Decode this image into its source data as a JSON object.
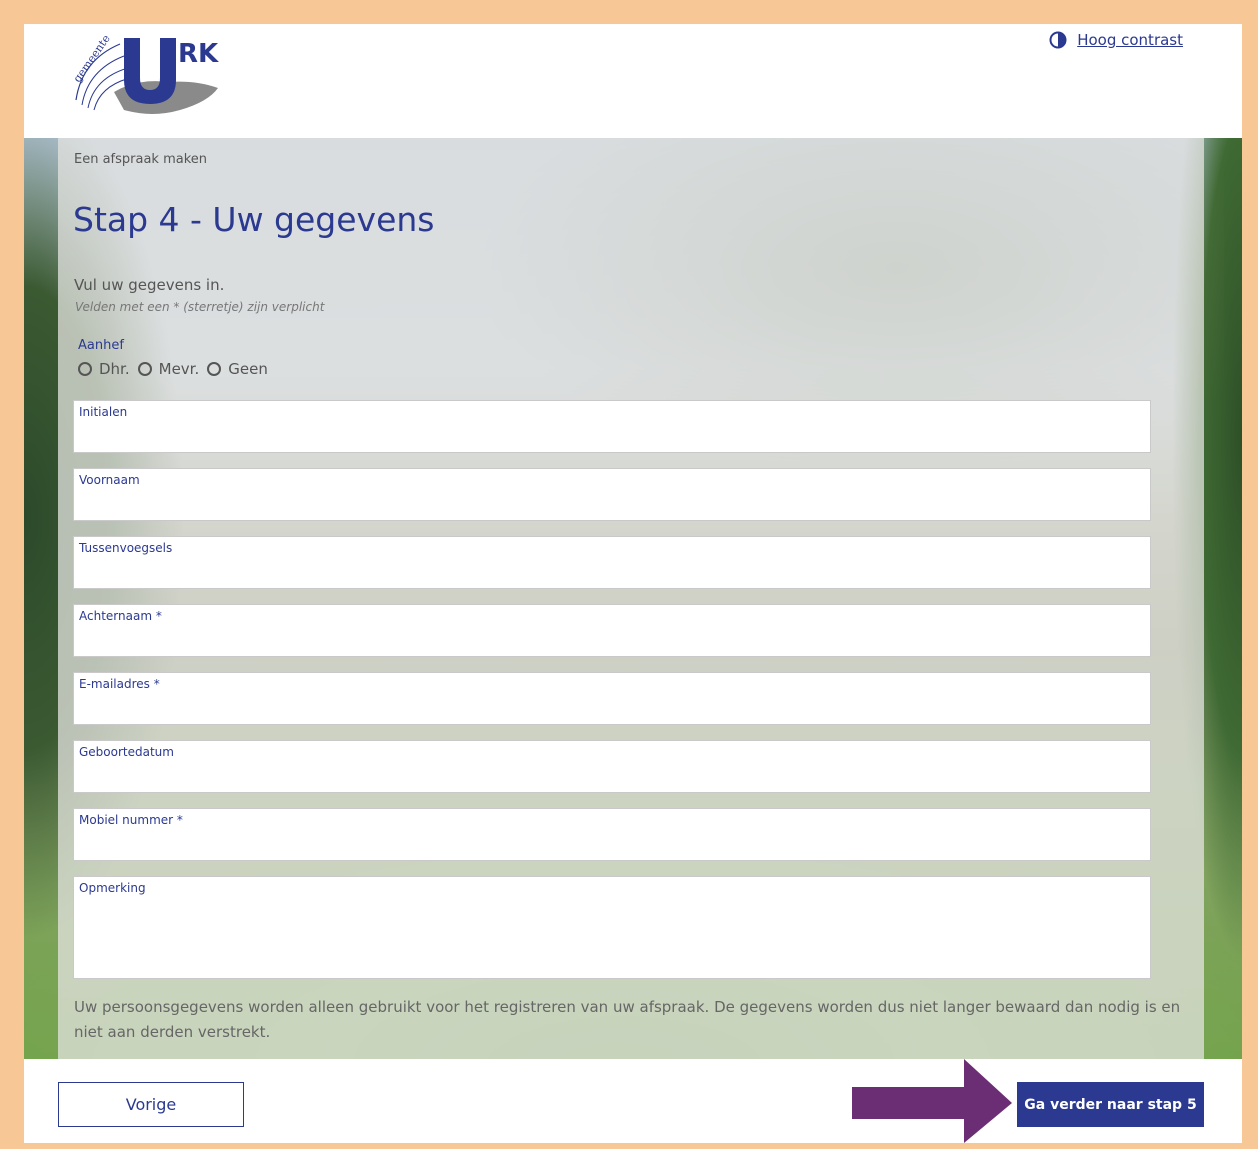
{
  "header": {
    "logo_text": "URK",
    "logo_arc_text": "gemeente",
    "contrast_link": "Hoog contrast"
  },
  "form": {
    "breadcrumb": "Een afspraak maken",
    "title": "Stap 4 - Uw gegevens",
    "intro": "Vul uw gegevens in.",
    "required_note": "Velden met een * (sterretje) zijn verplicht",
    "aanhef": {
      "label": "Aanhef",
      "options": [
        "Dhr.",
        "Mevr.",
        "Geen"
      ]
    },
    "fields": {
      "initialen": "Initialen",
      "voornaam": "Voornaam",
      "tussenvoegsels": "Tussenvoegsels",
      "achternaam": "Achternaam *",
      "email": "E-mailadres *",
      "geboortedatum": "Geboortedatum",
      "mobiel": "Mobiel nummer *",
      "opmerking": "Opmerking"
    },
    "privacy": "Uw persoonsgegevens worden alleen gebruikt voor het registreren van uw afspraak. De gegevens worden dus niet langer bewaard dan nodig is en niet aan derden verstrekt."
  },
  "footer": {
    "prev_label": "Vorige",
    "next_label": "Ga verder naar stap 5"
  },
  "colors": {
    "brand": "#2b3990",
    "page_border": "#f7c896",
    "annotation_arrow": "#6b2d73"
  },
  "icons": {
    "contrast": "half-circle-contrast-icon",
    "arrow": "arrow-right-icon"
  }
}
